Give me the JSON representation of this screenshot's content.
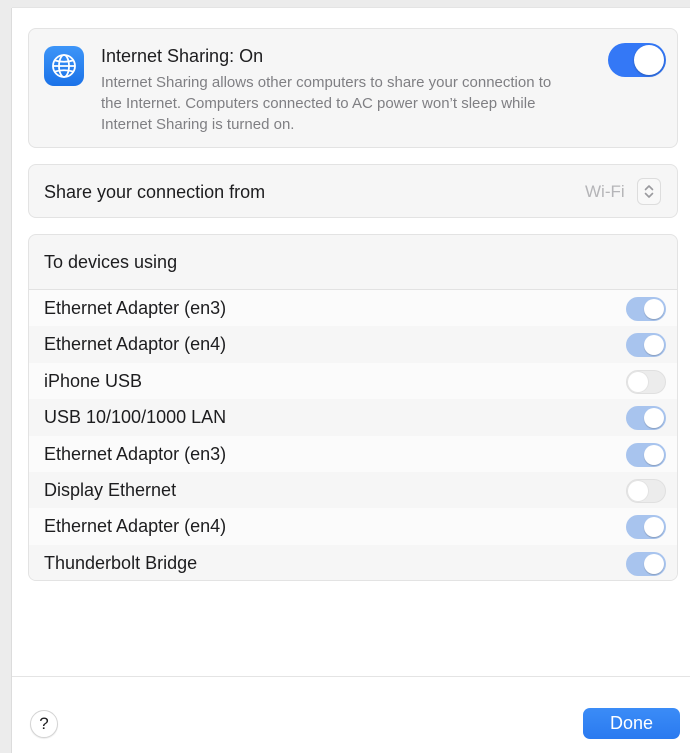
{
  "header": {
    "title": "Internet Sharing: On",
    "description": "Internet Sharing allows other computers to share your connection to the Internet. Computers connected to AC power won’t sleep while Internet Sharing is turned on.",
    "icon": "globe-icon",
    "enabled": true
  },
  "share_from": {
    "label": "Share your connection from",
    "value": "Wi-Fi"
  },
  "devices": {
    "header": "To devices using",
    "items": [
      {
        "label": "Ethernet Adapter (en3)",
        "enabled": true
      },
      {
        "label": "Ethernet Adaptor (en4)",
        "enabled": true
      },
      {
        "label": "iPhone USB",
        "enabled": false
      },
      {
        "label": "USB 10/100/1000 LAN",
        "enabled": true
      },
      {
        "label": "Ethernet Adaptor (en3)",
        "enabled": true
      },
      {
        "label": "Display Ethernet",
        "enabled": false
      },
      {
        "label": "Ethernet Adapter (en4)",
        "enabled": true
      },
      {
        "label": "Thunderbolt Bridge",
        "enabled": true
      }
    ]
  },
  "footer": {
    "help_label": "?",
    "done_label": "Done"
  },
  "colors": {
    "accent": "#3478f6",
    "toggle_on_dimmed": "#a8c4ee",
    "secondary_text": "#7f7f83"
  }
}
